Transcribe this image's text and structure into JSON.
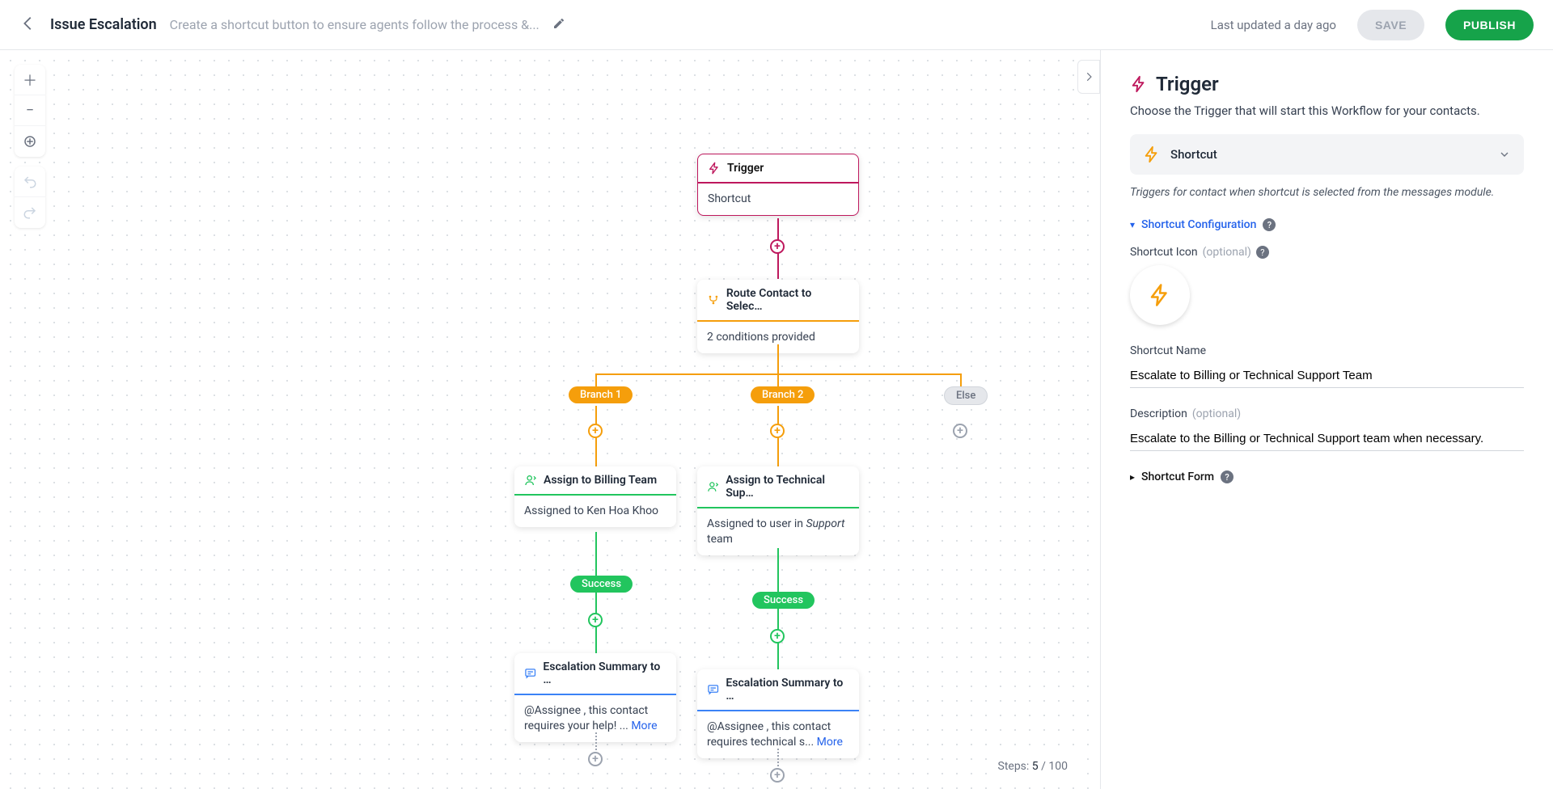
{
  "header": {
    "title": "Issue Escalation",
    "subtitle": "Create a shortcut button to ensure agents follow the process &...",
    "last_updated": "Last updated a day ago",
    "save_label": "SAVE",
    "publish_label": "PUBLISH"
  },
  "canvas": {
    "trigger": {
      "title": "Trigger",
      "body": "Shortcut"
    },
    "route": {
      "title": "Route Contact to Selec…",
      "body": "2 conditions provided"
    },
    "branches": {
      "b1": "Branch 1",
      "b2": "Branch 2",
      "else": "Else"
    },
    "assign1": {
      "title": "Assign to Billing Team",
      "body": "Assigned to Ken Hoa Khoo"
    },
    "assign2": {
      "title": "Assign to Technical Sup…",
      "body_prefix": "Assigned to user in ",
      "body_em": "Support",
      "body_suffix": " team"
    },
    "success": "Success",
    "msg1": {
      "title": "Escalation Summary to …",
      "body": "@Assignee , this contact requires your help! ... ",
      "more": "More"
    },
    "msg2": {
      "title": "Escalation Summary to …",
      "body": "@Assignee , this contact requires technical s... ",
      "more": "More"
    },
    "steps_label": "Steps:",
    "steps_cur": "5",
    "steps_sep": " / ",
    "steps_max": "100"
  },
  "sidebar": {
    "heading": "Trigger",
    "desc": "Choose the Trigger that will start this Workflow for your contacts.",
    "selector": {
      "label": "Shortcut"
    },
    "selector_hint": "Triggers for contact when shortcut is selected from the messages module.",
    "sec_config": "Shortcut Configuration",
    "icon_label_a": "Shortcut Icon",
    "icon_label_b": "(optional)",
    "name_label": "Shortcut Name",
    "name_value": "Escalate to Billing or Technical Support Team",
    "desc_label_a": "Description",
    "desc_label_b": "(optional)",
    "desc_value": "Escalate to the Billing or Technical Support team when necessary.",
    "sec_form": "Shortcut Form"
  }
}
